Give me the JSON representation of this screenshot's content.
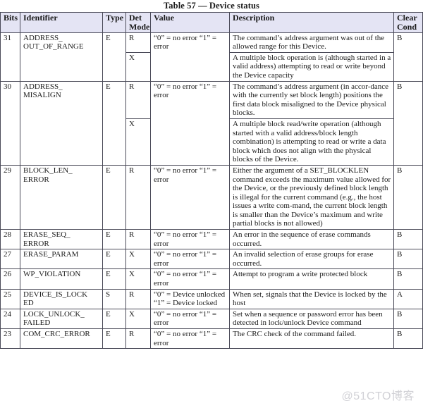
{
  "caption": "Table 57 — Device status",
  "watermark": "@51CTO博客",
  "table": {
    "headers": {
      "bits": "Bits",
      "identifier": "Identifier",
      "type": "Type",
      "det_mode": "Det\nMode",
      "value": "Value",
      "description": "Description",
      "clear_cond": "Clear\nCond"
    },
    "rows": [
      {
        "bits": "31",
        "identifier": "ADDRESS_\nOUT_OF_RANGE",
        "type": "E",
        "value": "“0” = no error\n“1” = error",
        "clear_cond": "B",
        "sub": [
          {
            "det_mode": "R",
            "description": "The command’s address argument was out of the allowed range for this Device."
          },
          {
            "det_mode": "X",
            "description": "A multiple block operation is (although started in a valid address) attempting to read or write beyond the Device capacity"
          }
        ]
      },
      {
        "bits": "30",
        "identifier": "ADDRESS_\nMISALIGN",
        "type": "E",
        "value": "“0” = no error\n“1” = error",
        "clear_cond": "B",
        "sub": [
          {
            "det_mode": "R",
            "description": "The command’s address argument (in accor-dance with the currently set block length) positions the first data block misaligned to the Device physical blocks."
          },
          {
            "det_mode": "X",
            "description": "A multiple block read/write operation (although started with a valid address/block length combination) is attempting to read or write a data block which does not align with the physical blocks of the Device."
          }
        ]
      },
      {
        "bits": "29",
        "identifier": "BLOCK_LEN_\nERROR",
        "type": "E",
        "value": "“0” = no error\n“1” = error",
        "clear_cond": "B",
        "sub": [
          {
            "det_mode": "R",
            "description": "Either the argument of a SET_BLOCKLEN command exceeds the maximum value allowed for the Device, or the previously defined block length is illegal for the current command (e.g., the host issues a write com-mand, the current block length is smaller than the Device’s maximum and write partial blocks is not allowed)"
          }
        ]
      },
      {
        "bits": "28",
        "identifier": "ERASE_SEQ_\nERROR",
        "type": "E",
        "value": "“0” = no error “1” = error",
        "clear_cond": "B",
        "sub": [
          {
            "det_mode": "R",
            "description": "An error in the sequence of erase commands occurred."
          }
        ]
      },
      {
        "bits": "27",
        "identifier": "ERASE_PARAM",
        "type": "E",
        "value": "“0” = no error “1” = error",
        "clear_cond": "B",
        "sub": [
          {
            "det_mode": "X",
            "description": "An invalid selection of erase groups for erase occurred."
          }
        ]
      },
      {
        "bits": "26",
        "identifier": "WP_VIOLATION",
        "type": "E",
        "value": "“0” = no error “1” = error",
        "clear_cond": "B",
        "sub": [
          {
            "det_mode": "X",
            "description": "Attempt to program a write protected block"
          }
        ]
      },
      {
        "bits": "25",
        "identifier": "DEVICE_IS_LOCK\nED",
        "type": "S",
        "value": "“0” = Device unlocked “1” = Device locked",
        "clear_cond": "A",
        "sub": [
          {
            "det_mode": "R",
            "description": "When set, signals that the Device is locked by the host"
          }
        ]
      },
      {
        "bits": "24",
        "identifier": "LOCK_UNLOCK_\nFAILED",
        "type": "E",
        "value": "“0” = no error “1” = error",
        "clear_cond": "B",
        "sub": [
          {
            "det_mode": "X",
            "description": "Set when a sequence or password error has been detected in lock/unlock Device command"
          }
        ]
      },
      {
        "bits": "23",
        "identifier": "COM_CRC_ERROR",
        "type": "E",
        "value": "“0” = no error “1” = error",
        "clear_cond": "B",
        "sub": [
          {
            "det_mode": "R",
            "description": "The CRC check of the command failed."
          }
        ]
      }
    ]
  }
}
